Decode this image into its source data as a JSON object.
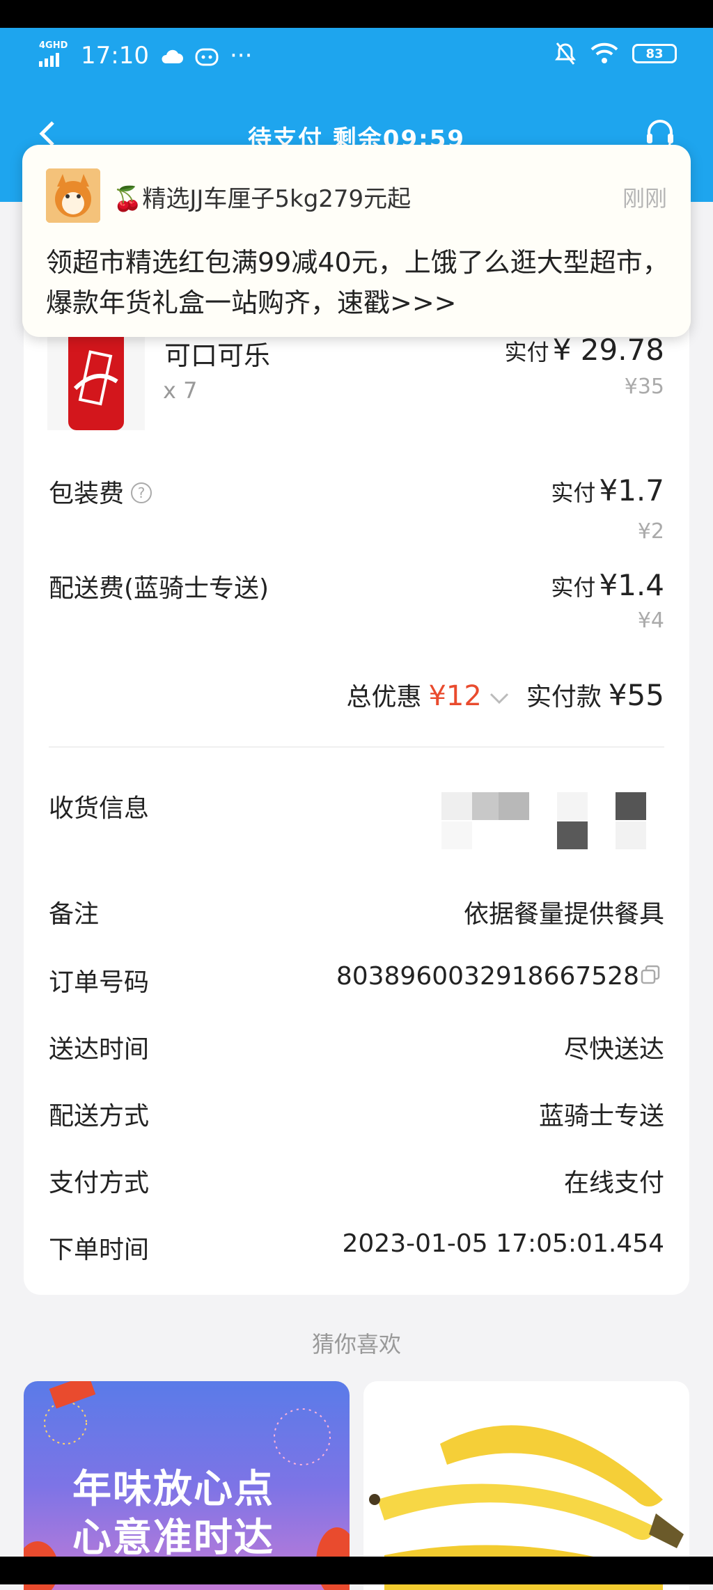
{
  "status": {
    "network": "4GHD",
    "time": "17:10",
    "battery": "83",
    "more": "···"
  },
  "nav": {
    "title": "待支付  剩余09:59"
  },
  "toast": {
    "title": "🍒精选JJ车厘子5kg279元起",
    "time": "刚刚",
    "body": "领超市精选红包满99减40元，上饿了么逛大型超市，爆款年货礼盒一站购齐，速戳>>>"
  },
  "product": {
    "name": "可口可乐",
    "qty": "x 7",
    "paid_label": "实付",
    "paid_value": "¥ 29.78",
    "original": "¥35"
  },
  "fees": [
    {
      "label": "包装费",
      "paid_label": "实付",
      "paid_value": "¥1.7",
      "original": "¥2"
    },
    {
      "label": "配送费(蓝骑士专送)",
      "paid_label": "实付",
      "paid_value": "¥1.4",
      "original": "¥4"
    }
  ],
  "summary": {
    "discount_label": "总优惠",
    "discount_value": "¥12",
    "total_label": "实付款",
    "total_value": "¥55"
  },
  "info": [
    {
      "label": "收货信息",
      "value": ""
    },
    {
      "label": "备注",
      "value": "依据餐量提供餐具"
    },
    {
      "label": "订单号码",
      "value": "8038960032918667528"
    },
    {
      "label": "送达时间",
      "value": "尽快送达"
    },
    {
      "label": "配送方式",
      "value": "蓝骑士专送"
    },
    {
      "label": "支付方式",
      "value": "在线支付"
    },
    {
      "label": "下单时间",
      "value": "2023-01-05 17:05:01.454"
    }
  ],
  "recommend": {
    "title": "猜你喜欢",
    "card1_line1": "年味放心点",
    "card1_line2": "心意准时达"
  },
  "colors": {
    "brand_blue": "#1ea5ee",
    "discount_red": "#e94b2e"
  }
}
